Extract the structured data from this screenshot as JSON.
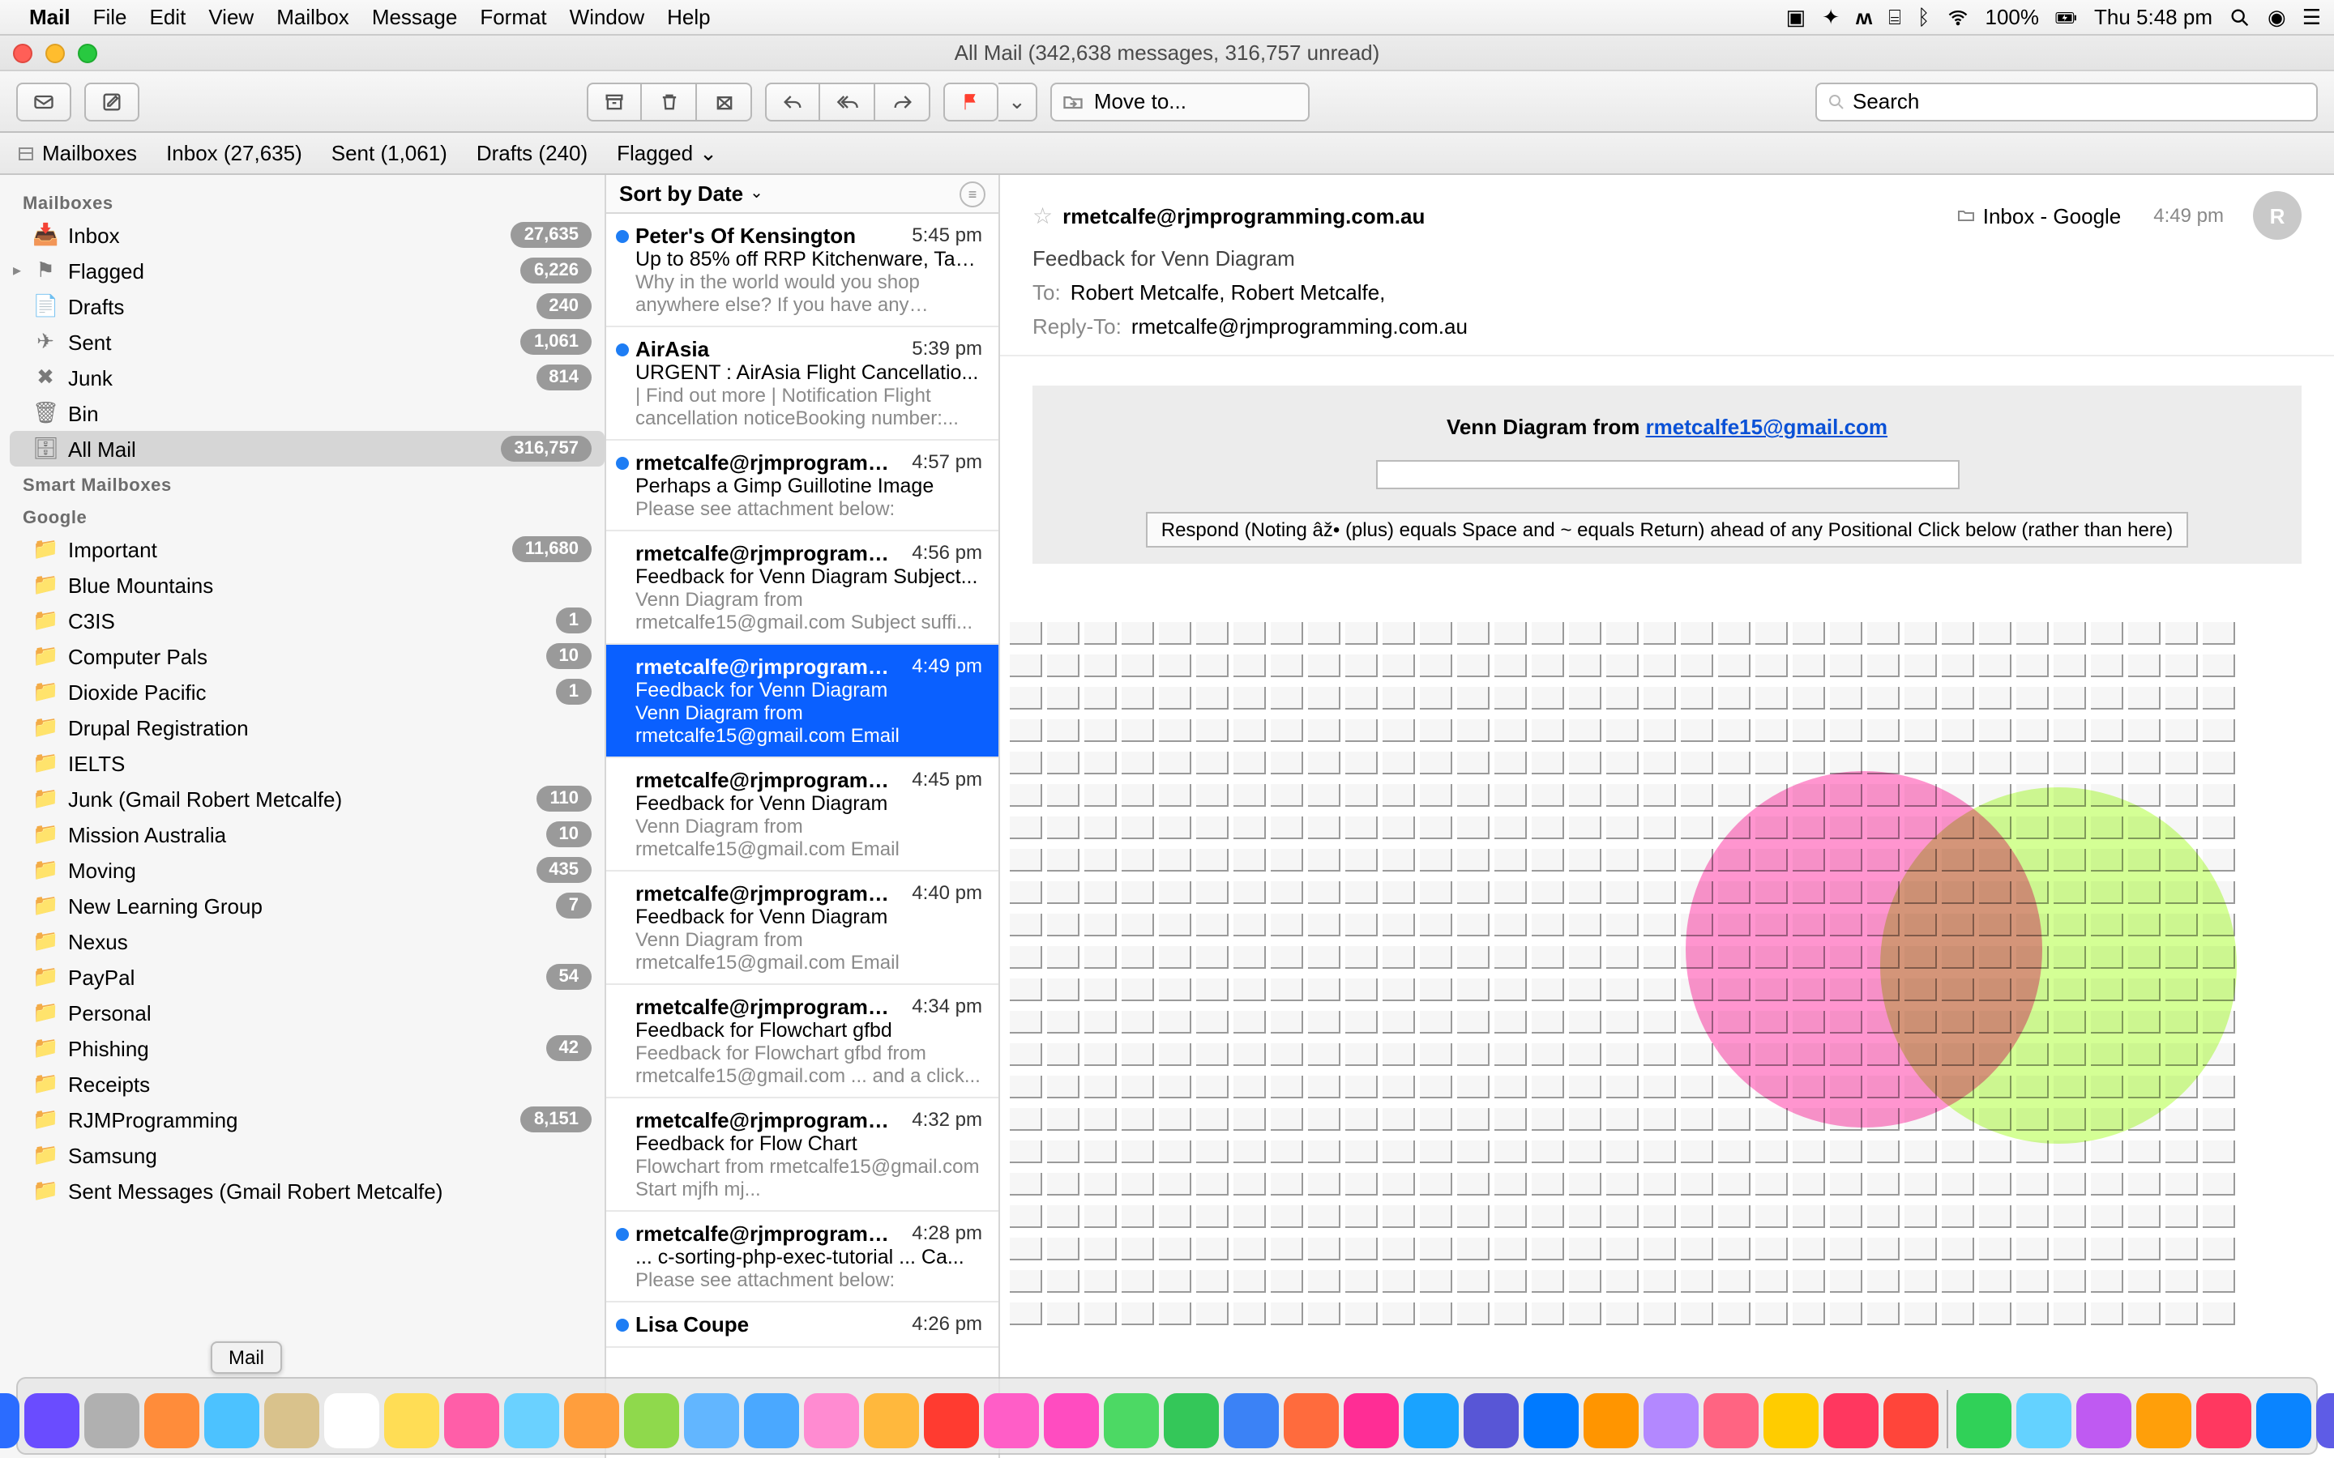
{
  "menubar": {
    "app": "Mail",
    "items": [
      "File",
      "Edit",
      "View",
      "Mailbox",
      "Message",
      "Format",
      "Window",
      "Help"
    ],
    "battery": "100%",
    "clock": "Thu 5:48 pm"
  },
  "window": {
    "title": "All Mail (342,638 messages, 316,757 unread)"
  },
  "toolbar": {
    "moveto_placeholder": "Move to...",
    "search_placeholder": "Search"
  },
  "favbar": {
    "mailboxes": "Mailboxes",
    "inbox": "Inbox (27,635)",
    "sent": "Sent (1,061)",
    "drafts": "Drafts (240)",
    "flagged": "Flagged"
  },
  "sidebar": {
    "hdr_mailboxes": "Mailboxes",
    "hdr_smart": "Smart Mailboxes",
    "hdr_google": "Google",
    "mailboxes": [
      {
        "label": "Inbox",
        "badge": "27,635",
        "icon": "📥"
      },
      {
        "label": "Flagged",
        "badge": "6,226",
        "icon": "⚑",
        "flag": true
      },
      {
        "label": "Drafts",
        "badge": "240",
        "icon": "📄"
      },
      {
        "label": "Sent",
        "badge": "1,061",
        "icon": "✈"
      },
      {
        "label": "Junk",
        "badge": "814",
        "icon": "✖"
      },
      {
        "label": "Bin",
        "badge": "",
        "icon": "🗑"
      },
      {
        "label": "All Mail",
        "badge": "316,757",
        "icon": "🗄",
        "sel": true
      }
    ],
    "google": [
      {
        "label": "Important",
        "badge": "11,680"
      },
      {
        "label": "Blue Mountains",
        "badge": ""
      },
      {
        "label": "C3IS",
        "badge": "1"
      },
      {
        "label": "Computer Pals",
        "badge": "10"
      },
      {
        "label": "Dioxide Pacific",
        "badge": "1"
      },
      {
        "label": "Drupal Registration",
        "badge": ""
      },
      {
        "label": "IELTS",
        "badge": ""
      },
      {
        "label": "Junk (Gmail Robert Metcalfe)",
        "badge": "110"
      },
      {
        "label": "Mission Australia",
        "badge": "10"
      },
      {
        "label": "Moving",
        "badge": "435"
      },
      {
        "label": "New Learning Group",
        "badge": "7"
      },
      {
        "label": "Nexus",
        "badge": ""
      },
      {
        "label": "PayPal",
        "badge": "54"
      },
      {
        "label": "Personal",
        "badge": ""
      },
      {
        "label": "Phishing",
        "badge": "42"
      },
      {
        "label": "Receipts",
        "badge": ""
      },
      {
        "label": "RJMProgramming",
        "badge": "8,151"
      },
      {
        "label": "Samsung",
        "badge": ""
      },
      {
        "label": "Sent Messages (Gmail Robert Metcalfe)",
        "badge": ""
      }
    ]
  },
  "msglist": {
    "sort": "Sort by Date",
    "items": [
      {
        "dot": true,
        "from": "Peter's Of Kensington",
        "time": "5:45 pm",
        "subj": "Up to 85% off RRP Kitchenware, Tab...",
        "prev": "Why in the world would you shop anywhere else? If you have any proble..."
      },
      {
        "dot": true,
        "from": "AirAsia",
        "time": "5:39 pm",
        "subj": "URGENT : AirAsia Flight Cancellatio...",
        "prev": "| Find out more | Notification Flight cancellation noticeBooking number:..."
      },
      {
        "dot": true,
        "from": "rmetcalfe@rjmprogrammi...",
        "time": "4:57 pm",
        "subj": "Perhaps a Gimp Guillotine Image",
        "prev": "Please see attachment below:"
      },
      {
        "dot": false,
        "from": "rmetcalfe@rjmprogrammi...",
        "time": "4:56 pm",
        "subj": "Feedback for Venn Diagram Subject...",
        "prev": "Venn Diagram from rmetcalfe15@gmail.com Subject suffi..."
      },
      {
        "dot": false,
        "sel": true,
        "from": "rmetcalfe@rjmprogrammi...",
        "time": "4:49 pm",
        "subj": "Feedback for Venn Diagram",
        "prev": "Venn Diagram from rmetcalfe15@gmail.com Email"
      },
      {
        "dot": false,
        "from": "rmetcalfe@rjmprogrammi...",
        "time": "4:45 pm",
        "subj": "Feedback for Venn Diagram",
        "prev": "Venn Diagram from rmetcalfe15@gmail.com Email"
      },
      {
        "dot": false,
        "from": "rmetcalfe@rjmprogrammi...",
        "time": "4:40 pm",
        "subj": "Feedback for Venn Diagram",
        "prev": "Venn Diagram from rmetcalfe15@gmail.com Email"
      },
      {
        "dot": false,
        "from": "rmetcalfe@rjmprogrammi...",
        "time": "4:34 pm",
        "subj": "Feedback for Flowchart gfbd",
        "prev": "Feedback for Flowchart gfbd from rmetcalfe15@gmail.com ... and a click..."
      },
      {
        "dot": false,
        "from": "rmetcalfe@rjmprogrammi...",
        "time": "4:32 pm",
        "subj": "Feedback for Flow Chart",
        "prev": "Flowchart from rmetcalfe15@gmail.com Start mjfh mj..."
      },
      {
        "dot": true,
        "from": "rmetcalfe@rjmprogrammi...",
        "time": "4:28 pm",
        "subj": "... c-sorting-php-exec-tutorial ... Ca...",
        "prev": "Please see attachment below:"
      },
      {
        "dot": true,
        "from": "Lisa Coupe",
        "time": "4:26 pm",
        "subj": "",
        "prev": ""
      }
    ]
  },
  "reader": {
    "from": "rmetcalfe@rjmprogramming.com.au",
    "location": "Inbox - Google",
    "time": "4:49 pm",
    "avatar": "R",
    "subject": "Feedback for Venn Diagram",
    "to_label": "To:",
    "to": "Robert Metcalfe,     Robert Metcalfe,",
    "replyto_label": "Reply-To:",
    "replyto": "rmetcalfe@rjmprogramming.com.au",
    "banner_prefix": "Venn Diagram from ",
    "banner_link": "rmetcalfe15@gmail.com",
    "respond": "Respond (Noting âž• (plus) equals Space and ~ equals Return) ahead of any Positional Click below (rather than here)"
  },
  "dock": {
    "tooltip": "Mail"
  }
}
